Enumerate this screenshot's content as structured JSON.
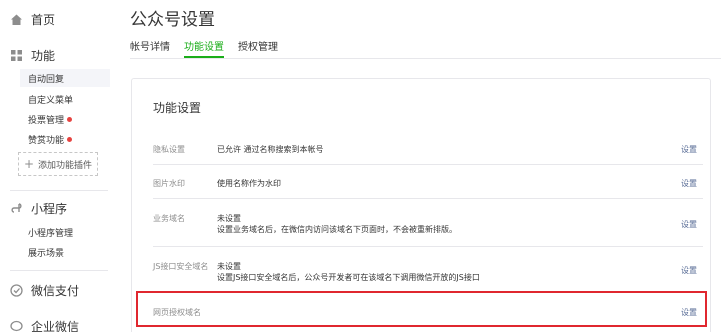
{
  "sidebar": {
    "home": "首页",
    "features": "功能",
    "feature_items": [
      {
        "label": "自动回复",
        "dot": false
      },
      {
        "label": "自定义菜单",
        "dot": false
      },
      {
        "label": "投票管理",
        "dot": true
      },
      {
        "label": "赞赏功能",
        "dot": true
      }
    ],
    "add_plugin": "添加功能插件",
    "mini_program": "小程序",
    "mini_items": [
      "小程序管理",
      "展示场景"
    ],
    "wechat_pay": "微信支付",
    "enterprise_wechat": "企业微信"
  },
  "page": {
    "title": "公众号设置",
    "tabs": [
      "帐号详情",
      "功能设置",
      "授权管理"
    ]
  },
  "card": {
    "title": "功能设置",
    "rows": [
      {
        "label": "隐私设置",
        "value": "已允许 通过名称搜索到本帐号",
        "value2": "",
        "action": "设置"
      },
      {
        "label": "图片水印",
        "value": "使用名称作为水印",
        "value2": "",
        "action": "设置"
      },
      {
        "label": "业务域名",
        "value": "未设置",
        "value2": "设置业务域名后，在微信内访问该域名下页面时，不会被重新排版。",
        "action": "设置"
      },
      {
        "label": "JS接口安全域名",
        "value": "未设置",
        "value2": "设置JS接口安全域名后，公众号开发者可在该域名下调用微信开放的JS接口",
        "action": "设置"
      },
      {
        "label": "网页授权域名",
        "value": "",
        "value2": "",
        "action": "设置"
      }
    ]
  },
  "colors": {
    "accent": "#1aad19",
    "link": "#576b95",
    "highlight": "#e0272f",
    "dot": "#e64340"
  }
}
